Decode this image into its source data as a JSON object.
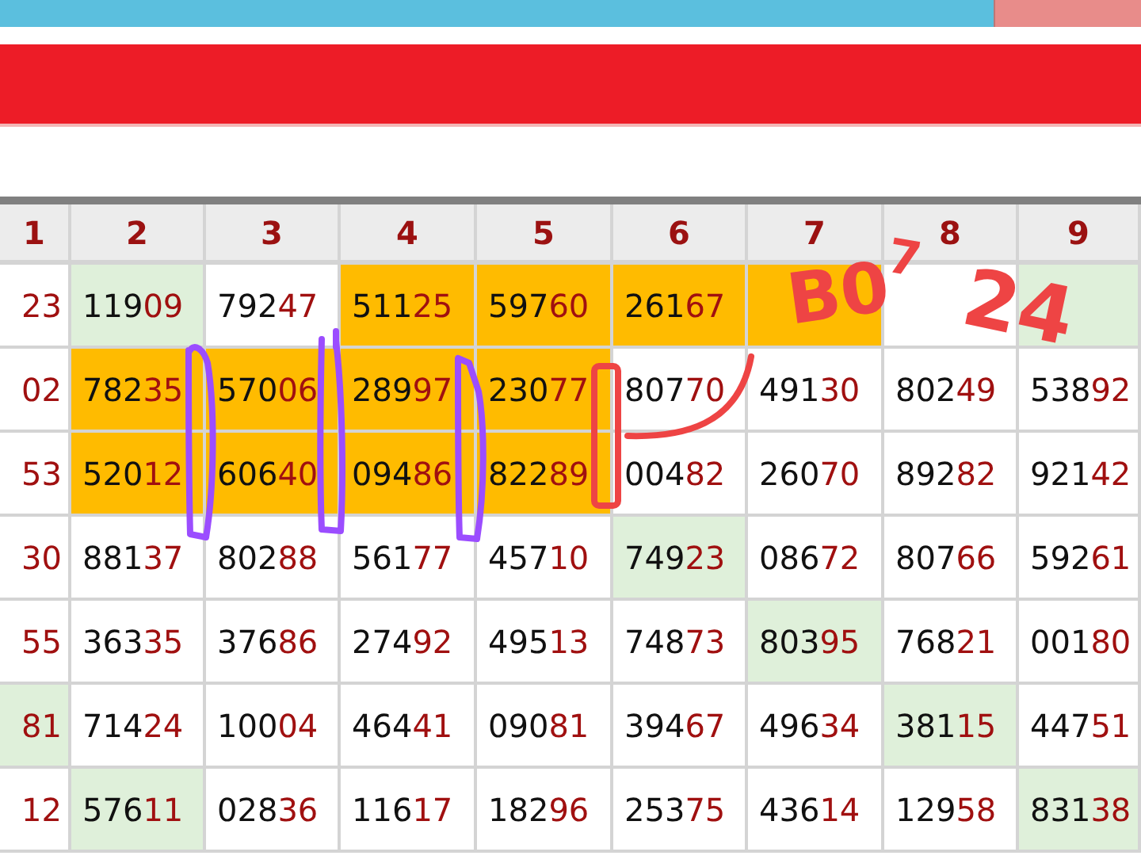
{
  "columns": [
    "1",
    "2",
    "3",
    "4",
    "5",
    "6",
    "7",
    "8",
    "9"
  ],
  "rows": [
    {
      "cells": [
        {
          "tail": "23",
          "color": "#ffffff"
        },
        {
          "head": "119",
          "tail": "09",
          "color": "#dff0da"
        },
        {
          "head": "792",
          "tail": "47",
          "color": "#ffffff"
        },
        {
          "head": "511",
          "tail": "25",
          "color": "#ffbb00"
        },
        {
          "head": "597",
          "tail": "60",
          "color": "#ffbb00"
        },
        {
          "head": "261",
          "tail": "67",
          "color": "#ffbb00"
        },
        {
          "color": "#ffbb00"
        },
        {
          "color": "#ffffff"
        },
        {
          "color": "#dff0da"
        }
      ]
    },
    {
      "cells": [
        {
          "tail": "02",
          "color": "#ffffff"
        },
        {
          "head": "782",
          "tail": "35",
          "color": "#ffbb00"
        },
        {
          "head": "570",
          "tail": "06",
          "color": "#ffbb00"
        },
        {
          "head": "289",
          "tail": "97",
          "color": "#ffbb00"
        },
        {
          "head": "230",
          "tail": "77",
          "color": "#ffbb00"
        },
        {
          "head": "807",
          "tail": "70",
          "color": "#ffffff"
        },
        {
          "head": "491",
          "tail": "30",
          "color": "#ffffff"
        },
        {
          "head": "802",
          "tail": "49",
          "color": "#ffffff"
        },
        {
          "head": "538",
          "tail": "92",
          "color": "#ffffff"
        }
      ]
    },
    {
      "cells": [
        {
          "tail": "53",
          "color": "#ffffff"
        },
        {
          "head": "520",
          "tail": "12",
          "color": "#ffbb00"
        },
        {
          "head": "606",
          "tail": "40",
          "color": "#ffbb00"
        },
        {
          "head": "094",
          "tail": "86",
          "color": "#ffbb00"
        },
        {
          "head": "822",
          "tail": "89",
          "color": "#ffbb00"
        },
        {
          "head": "004",
          "tail": "82",
          "color": "#ffffff"
        },
        {
          "head": "260",
          "tail": "70",
          "color": "#ffffff"
        },
        {
          "head": "892",
          "tail": "82",
          "color": "#ffffff"
        },
        {
          "head": "921",
          "tail": "42",
          "color": "#ffffff"
        }
      ]
    },
    {
      "cells": [
        {
          "tail": "30",
          "color": "#ffffff"
        },
        {
          "head": "881",
          "tail": "37",
          "color": "#ffffff"
        },
        {
          "head": "802",
          "tail": "88",
          "color": "#ffffff"
        },
        {
          "head": "561",
          "tail": "77",
          "color": "#ffffff"
        },
        {
          "head": "457",
          "tail": "10",
          "color": "#ffffff"
        },
        {
          "head": "749",
          "tail": "23",
          "color": "#dff0da"
        },
        {
          "head": "086",
          "tail": "72",
          "color": "#ffffff"
        },
        {
          "head": "807",
          "tail": "66",
          "color": "#ffffff"
        },
        {
          "head": "592",
          "tail": "61",
          "color": "#ffffff"
        }
      ]
    },
    {
      "cells": [
        {
          "tail": "55",
          "color": "#ffffff"
        },
        {
          "head": "363",
          "tail": "35",
          "color": "#ffffff"
        },
        {
          "head": "376",
          "tail": "86",
          "color": "#ffffff"
        },
        {
          "head": "274",
          "tail": "92",
          "color": "#ffffff"
        },
        {
          "head": "495",
          "tail": "13",
          "color": "#ffffff"
        },
        {
          "head": "748",
          "tail": "73",
          "color": "#ffffff"
        },
        {
          "head": "803",
          "tail": "95",
          "color": "#dff0da"
        },
        {
          "head": "768",
          "tail": "21",
          "color": "#ffffff"
        },
        {
          "head": "001",
          "tail": "80",
          "color": "#ffffff"
        }
      ]
    },
    {
      "cells": [
        {
          "tail": "81",
          "color": "#dff0da"
        },
        {
          "head": "714",
          "tail": "24",
          "color": "#ffffff"
        },
        {
          "head": "100",
          "tail": "04",
          "color": "#ffffff"
        },
        {
          "head": "464",
          "tail": "41",
          "color": "#ffffff"
        },
        {
          "head": "090",
          "tail": "81",
          "color": "#ffffff"
        },
        {
          "head": "394",
          "tail": "67",
          "color": "#ffffff"
        },
        {
          "head": "496",
          "tail": "34",
          "color": "#ffffff"
        },
        {
          "head": "381",
          "tail": "15",
          "color": "#dff0da"
        },
        {
          "head": "447",
          "tail": "51",
          "color": "#ffffff"
        }
      ]
    },
    {
      "cells": [
        {
          "tail": "12",
          "color": "#ffffff"
        },
        {
          "head": "576",
          "tail": "11",
          "color": "#dff0da"
        },
        {
          "head": "028",
          "tail": "36",
          "color": "#ffffff"
        },
        {
          "head": "116",
          "tail": "17",
          "color": "#ffffff"
        },
        {
          "head": "182",
          "tail": "96",
          "color": "#ffffff"
        },
        {
          "head": "253",
          "tail": "75",
          "color": "#ffffff"
        },
        {
          "head": "436",
          "tail": "14",
          "color": "#ffffff"
        },
        {
          "head": "129",
          "tail": "58",
          "color": "#ffffff"
        },
        {
          "head": "831",
          "tail": "38",
          "color": "#dff0da"
        }
      ]
    }
  ],
  "handwriting": [
    "B0",
    "7",
    "24"
  ]
}
